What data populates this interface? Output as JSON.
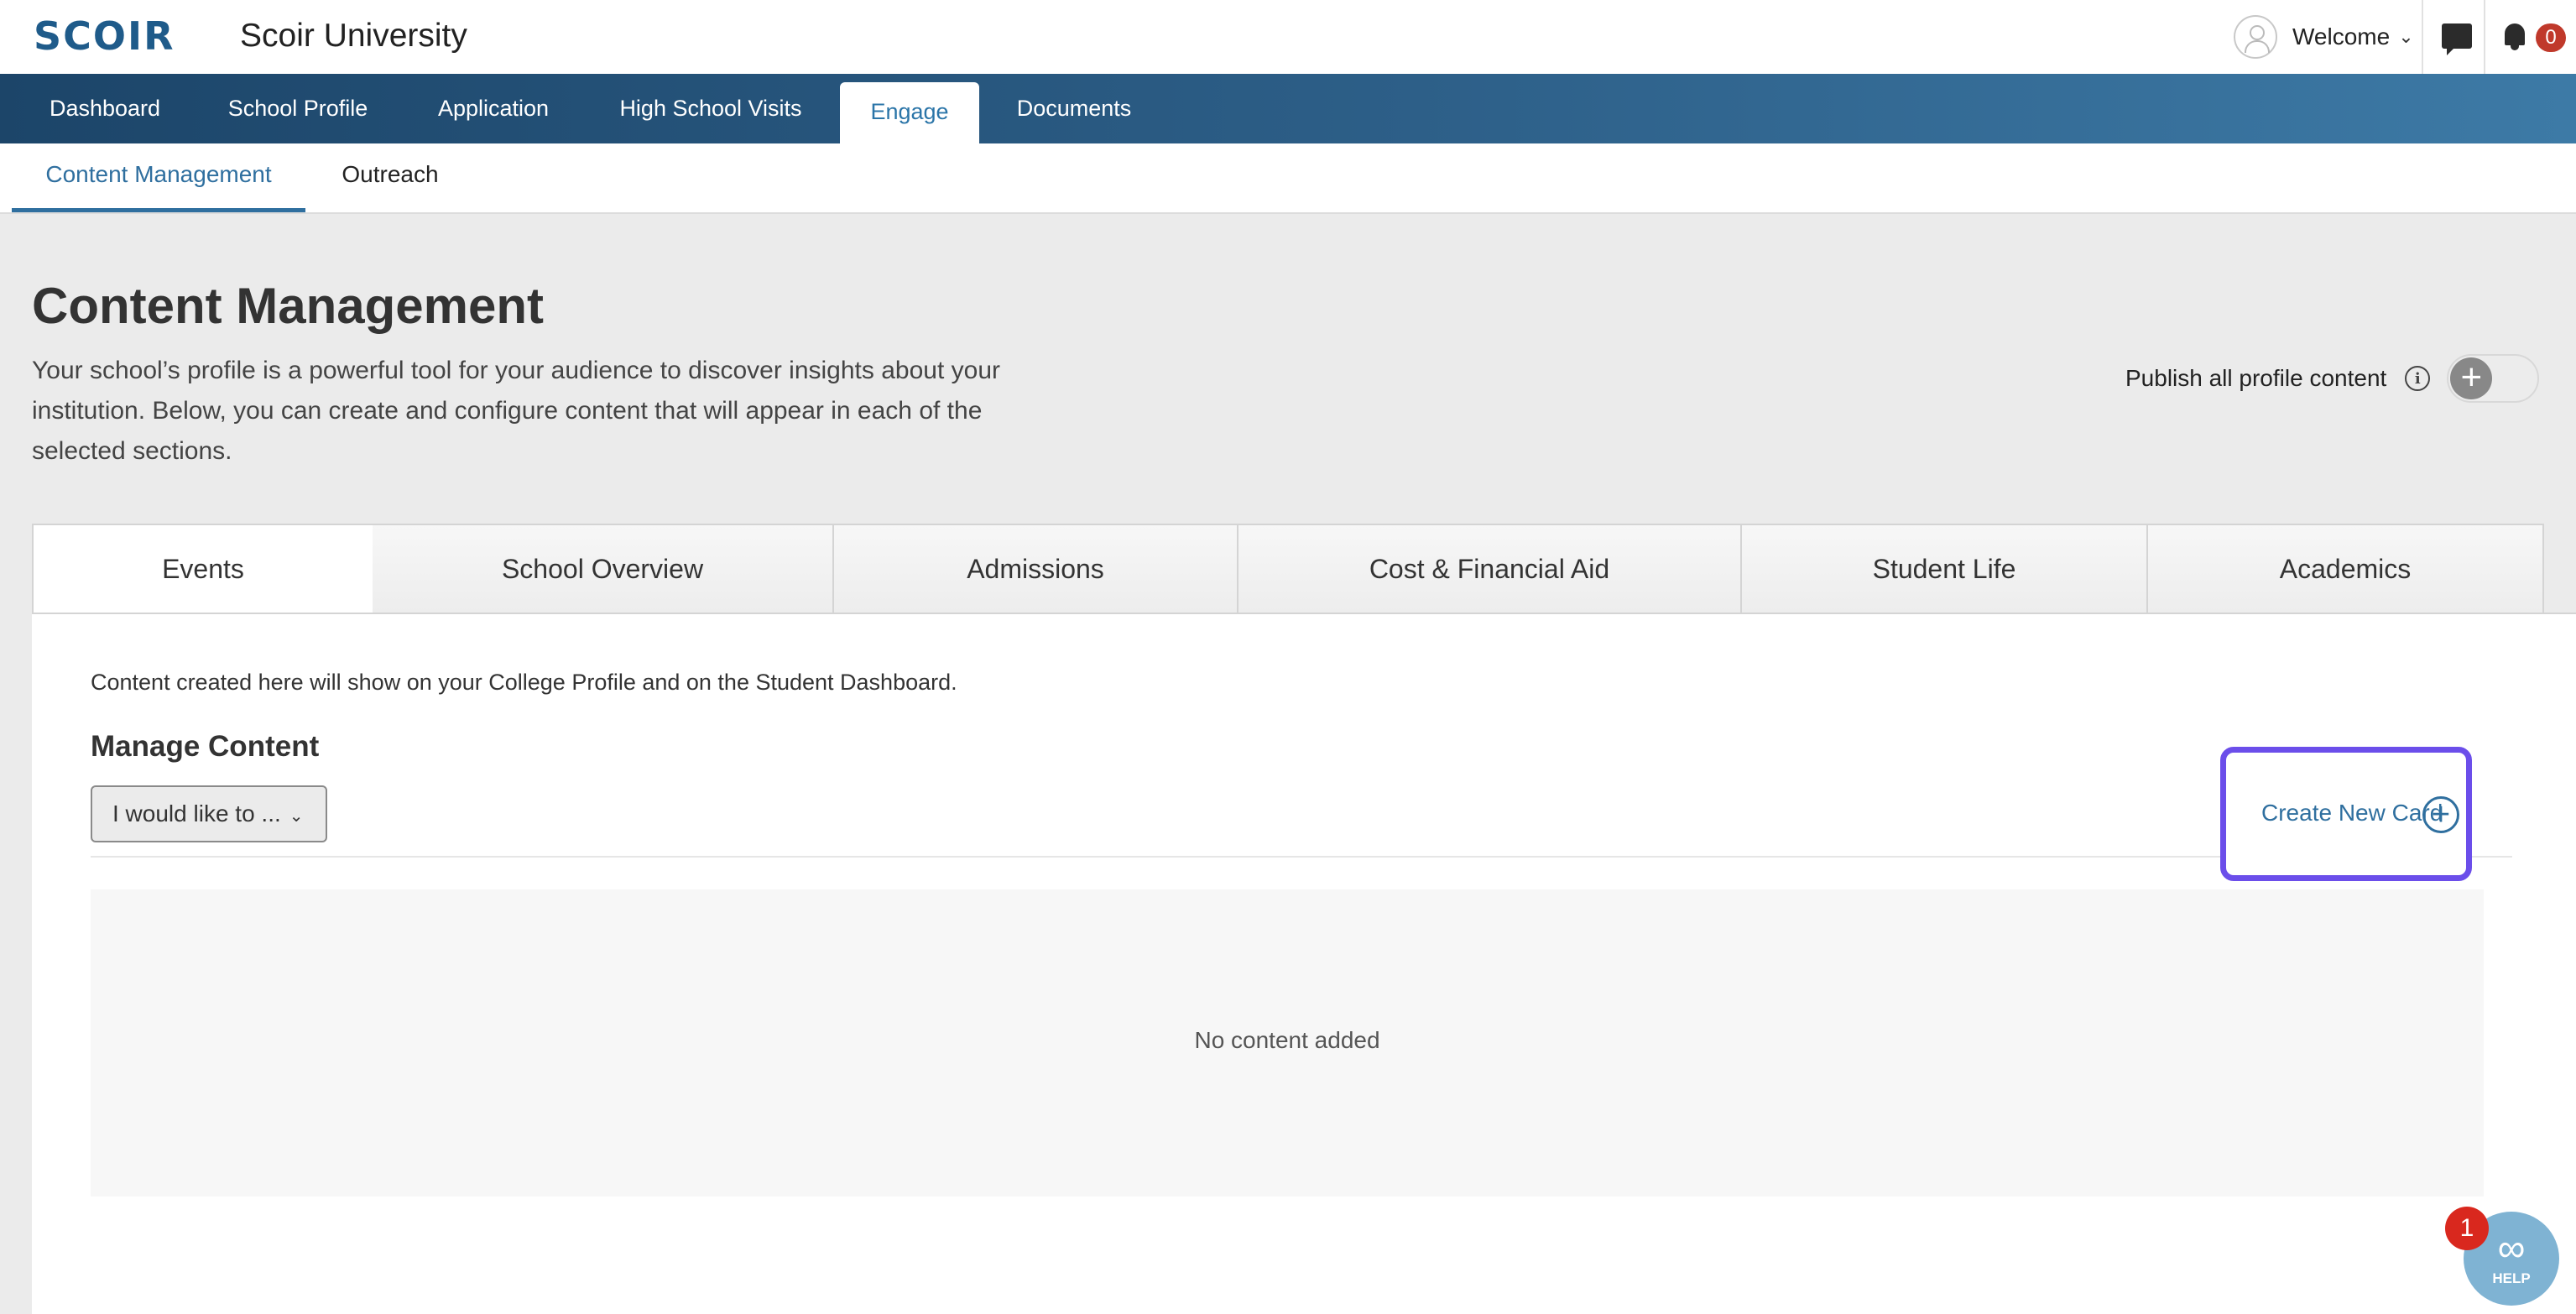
{
  "header": {
    "logo_text": "SCOIR",
    "org_name": "Scoir University",
    "welcome": "Welcome",
    "notifications_count": "0"
  },
  "main_nav": {
    "items": [
      {
        "label": "Dashboard"
      },
      {
        "label": "School Profile"
      },
      {
        "label": "Application"
      },
      {
        "label": "High School Visits"
      },
      {
        "label": "Engage"
      },
      {
        "label": "Documents"
      }
    ],
    "active": "Engage"
  },
  "sub_nav": {
    "items": [
      {
        "label": "Content Management"
      },
      {
        "label": "Outreach"
      }
    ],
    "active": "Content Management"
  },
  "page": {
    "title": "Content Management",
    "description": "Your school’s profile is a powerful tool for your audience to discover insights about your institution. Below, you can create and configure content that will appear in each of the selected sections."
  },
  "publish": {
    "label": "Publish all profile content",
    "toggle_symbol": "+"
  },
  "tabs": [
    {
      "label": "Events"
    },
    {
      "label": "School Overview"
    },
    {
      "label": "Admissions"
    },
    {
      "label": "Cost & Financial Aid"
    },
    {
      "label": "Student Life"
    },
    {
      "label": "Academics"
    }
  ],
  "active_tab": "Events",
  "panel": {
    "note": "Content created here will show on your College Profile and on the Student Dashboard.",
    "manage_title": "Manage Content",
    "dropdown_value": "I would like to ...",
    "create_button": "Create New Card",
    "empty_text": "No content added"
  },
  "help": {
    "label": "HELP",
    "badge": "1"
  },
  "colors": {
    "brand": "#1f5b8a",
    "link": "#2f6f9f",
    "highlight": "#6b4eea",
    "badge": "#d9281e"
  }
}
